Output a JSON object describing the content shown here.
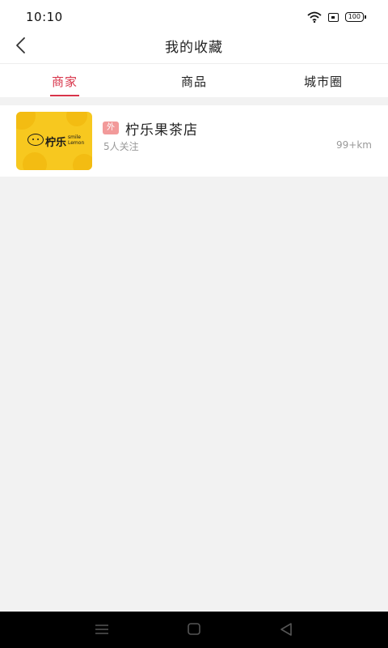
{
  "status_bar": {
    "time": "10:10",
    "battery": "100",
    "icons": [
      "wifi-icon",
      "sim-icon",
      "battery-icon"
    ]
  },
  "header": {
    "title": "我的收藏",
    "back_icon": "chevron-left-icon"
  },
  "tabs": [
    {
      "label": "商家",
      "active": true
    },
    {
      "label": "商品",
      "active": false
    },
    {
      "label": "城市圈",
      "active": false
    }
  ],
  "favorites": [
    {
      "badge": "外",
      "name": "柠乐果茶店",
      "followers": "5人关注",
      "distance": "99+km",
      "logo": {
        "cn": "柠乐",
        "en_line1": "smile",
        "en_line2": "Lemon"
      }
    }
  ],
  "system_nav": [
    "menu-icon",
    "home-icon",
    "back-icon"
  ],
  "colors": {
    "accent": "#d8344a",
    "badge": "#f29a9a",
    "logo_bg": "#f7c81f",
    "page_bg": "#f2f2f2"
  }
}
